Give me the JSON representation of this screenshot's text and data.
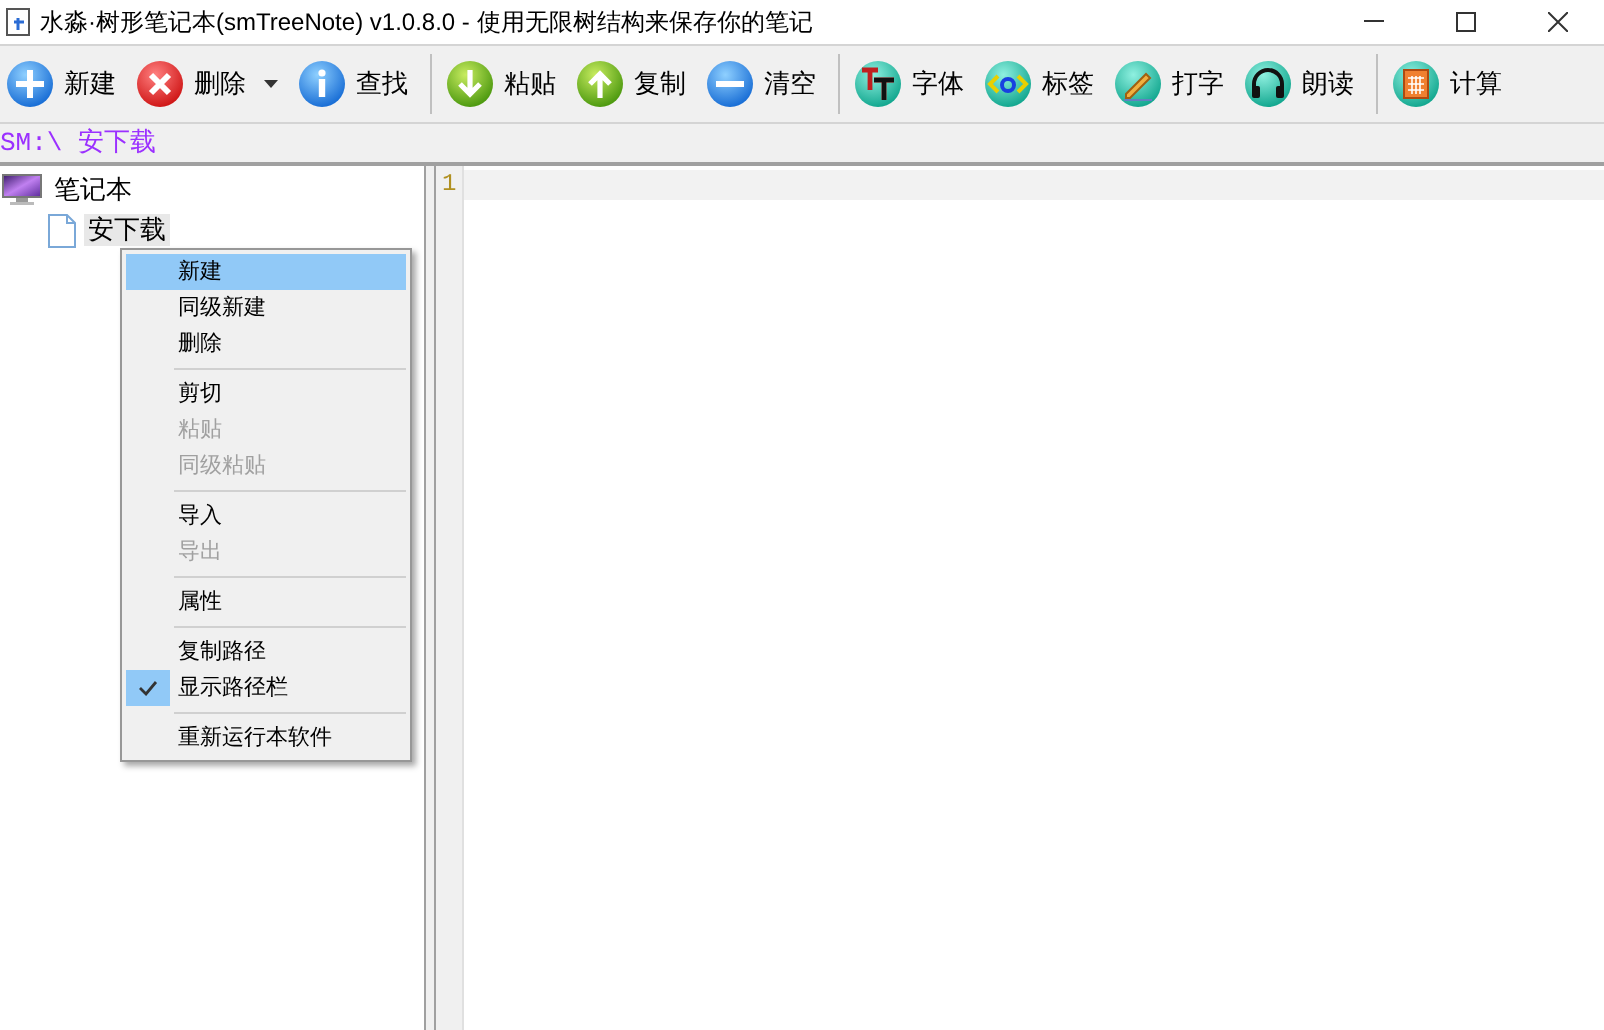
{
  "window": {
    "title": "水淼·树形笔记本(smTreeNote) v1.0.8.0 - 使用无限树结构来保存你的笔记"
  },
  "toolbar": {
    "groups": [
      [
        {
          "label": "新建",
          "has_menu": false
        },
        {
          "label": "删除",
          "has_menu": true
        },
        {
          "label": "查找",
          "has_menu": false
        }
      ],
      [
        {
          "label": "粘贴",
          "has_menu": false
        },
        {
          "label": "复制",
          "has_menu": false
        },
        {
          "label": "清空",
          "has_menu": false
        }
      ],
      [
        {
          "label": "字体",
          "has_menu": false
        },
        {
          "label": "标签",
          "has_menu": false
        },
        {
          "label": "打字",
          "has_menu": false
        },
        {
          "label": "朗读",
          "has_menu": false
        }
      ],
      [
        {
          "label": "计算",
          "has_menu": false
        }
      ]
    ]
  },
  "path_bar": {
    "text": "SM:\\ 安下载"
  },
  "tree": [
    {
      "label": "笔记本",
      "selected": false,
      "children": [
        {
          "label": "安下载",
          "selected": true
        }
      ]
    }
  ],
  "context_menu": [
    {
      "kind": "item",
      "label": "新建",
      "selected": true,
      "disabled": false,
      "checked": false
    },
    {
      "kind": "item",
      "label": "同级新建",
      "selected": false,
      "disabled": false,
      "checked": false
    },
    {
      "kind": "item",
      "label": "删除",
      "selected": false,
      "disabled": false,
      "checked": false
    },
    {
      "kind": "separator"
    },
    {
      "kind": "item",
      "label": "剪切",
      "selected": false,
      "disabled": false,
      "checked": false
    },
    {
      "kind": "item",
      "label": "粘贴",
      "selected": false,
      "disabled": true,
      "checked": false
    },
    {
      "kind": "item",
      "label": "同级粘贴",
      "selected": false,
      "disabled": true,
      "checked": false
    },
    {
      "kind": "separator"
    },
    {
      "kind": "item",
      "label": "导入",
      "selected": false,
      "disabled": false,
      "checked": false
    },
    {
      "kind": "item",
      "label": "导出",
      "selected": false,
      "disabled": true,
      "checked": false
    },
    {
      "kind": "separator"
    },
    {
      "kind": "item",
      "label": "属性",
      "selected": false,
      "disabled": false,
      "checked": false
    },
    {
      "kind": "separator"
    },
    {
      "kind": "item",
      "label": "复制路径",
      "selected": false,
      "disabled": false,
      "checked": false
    },
    {
      "kind": "item",
      "label": "显示路径栏",
      "selected": false,
      "disabled": false,
      "checked": true
    },
    {
      "kind": "separator"
    },
    {
      "kind": "item",
      "label": "重新运行本软件",
      "selected": false,
      "disabled": false,
      "checked": false
    }
  ],
  "editor": {
    "line_numbers": [
      "1"
    ]
  }
}
